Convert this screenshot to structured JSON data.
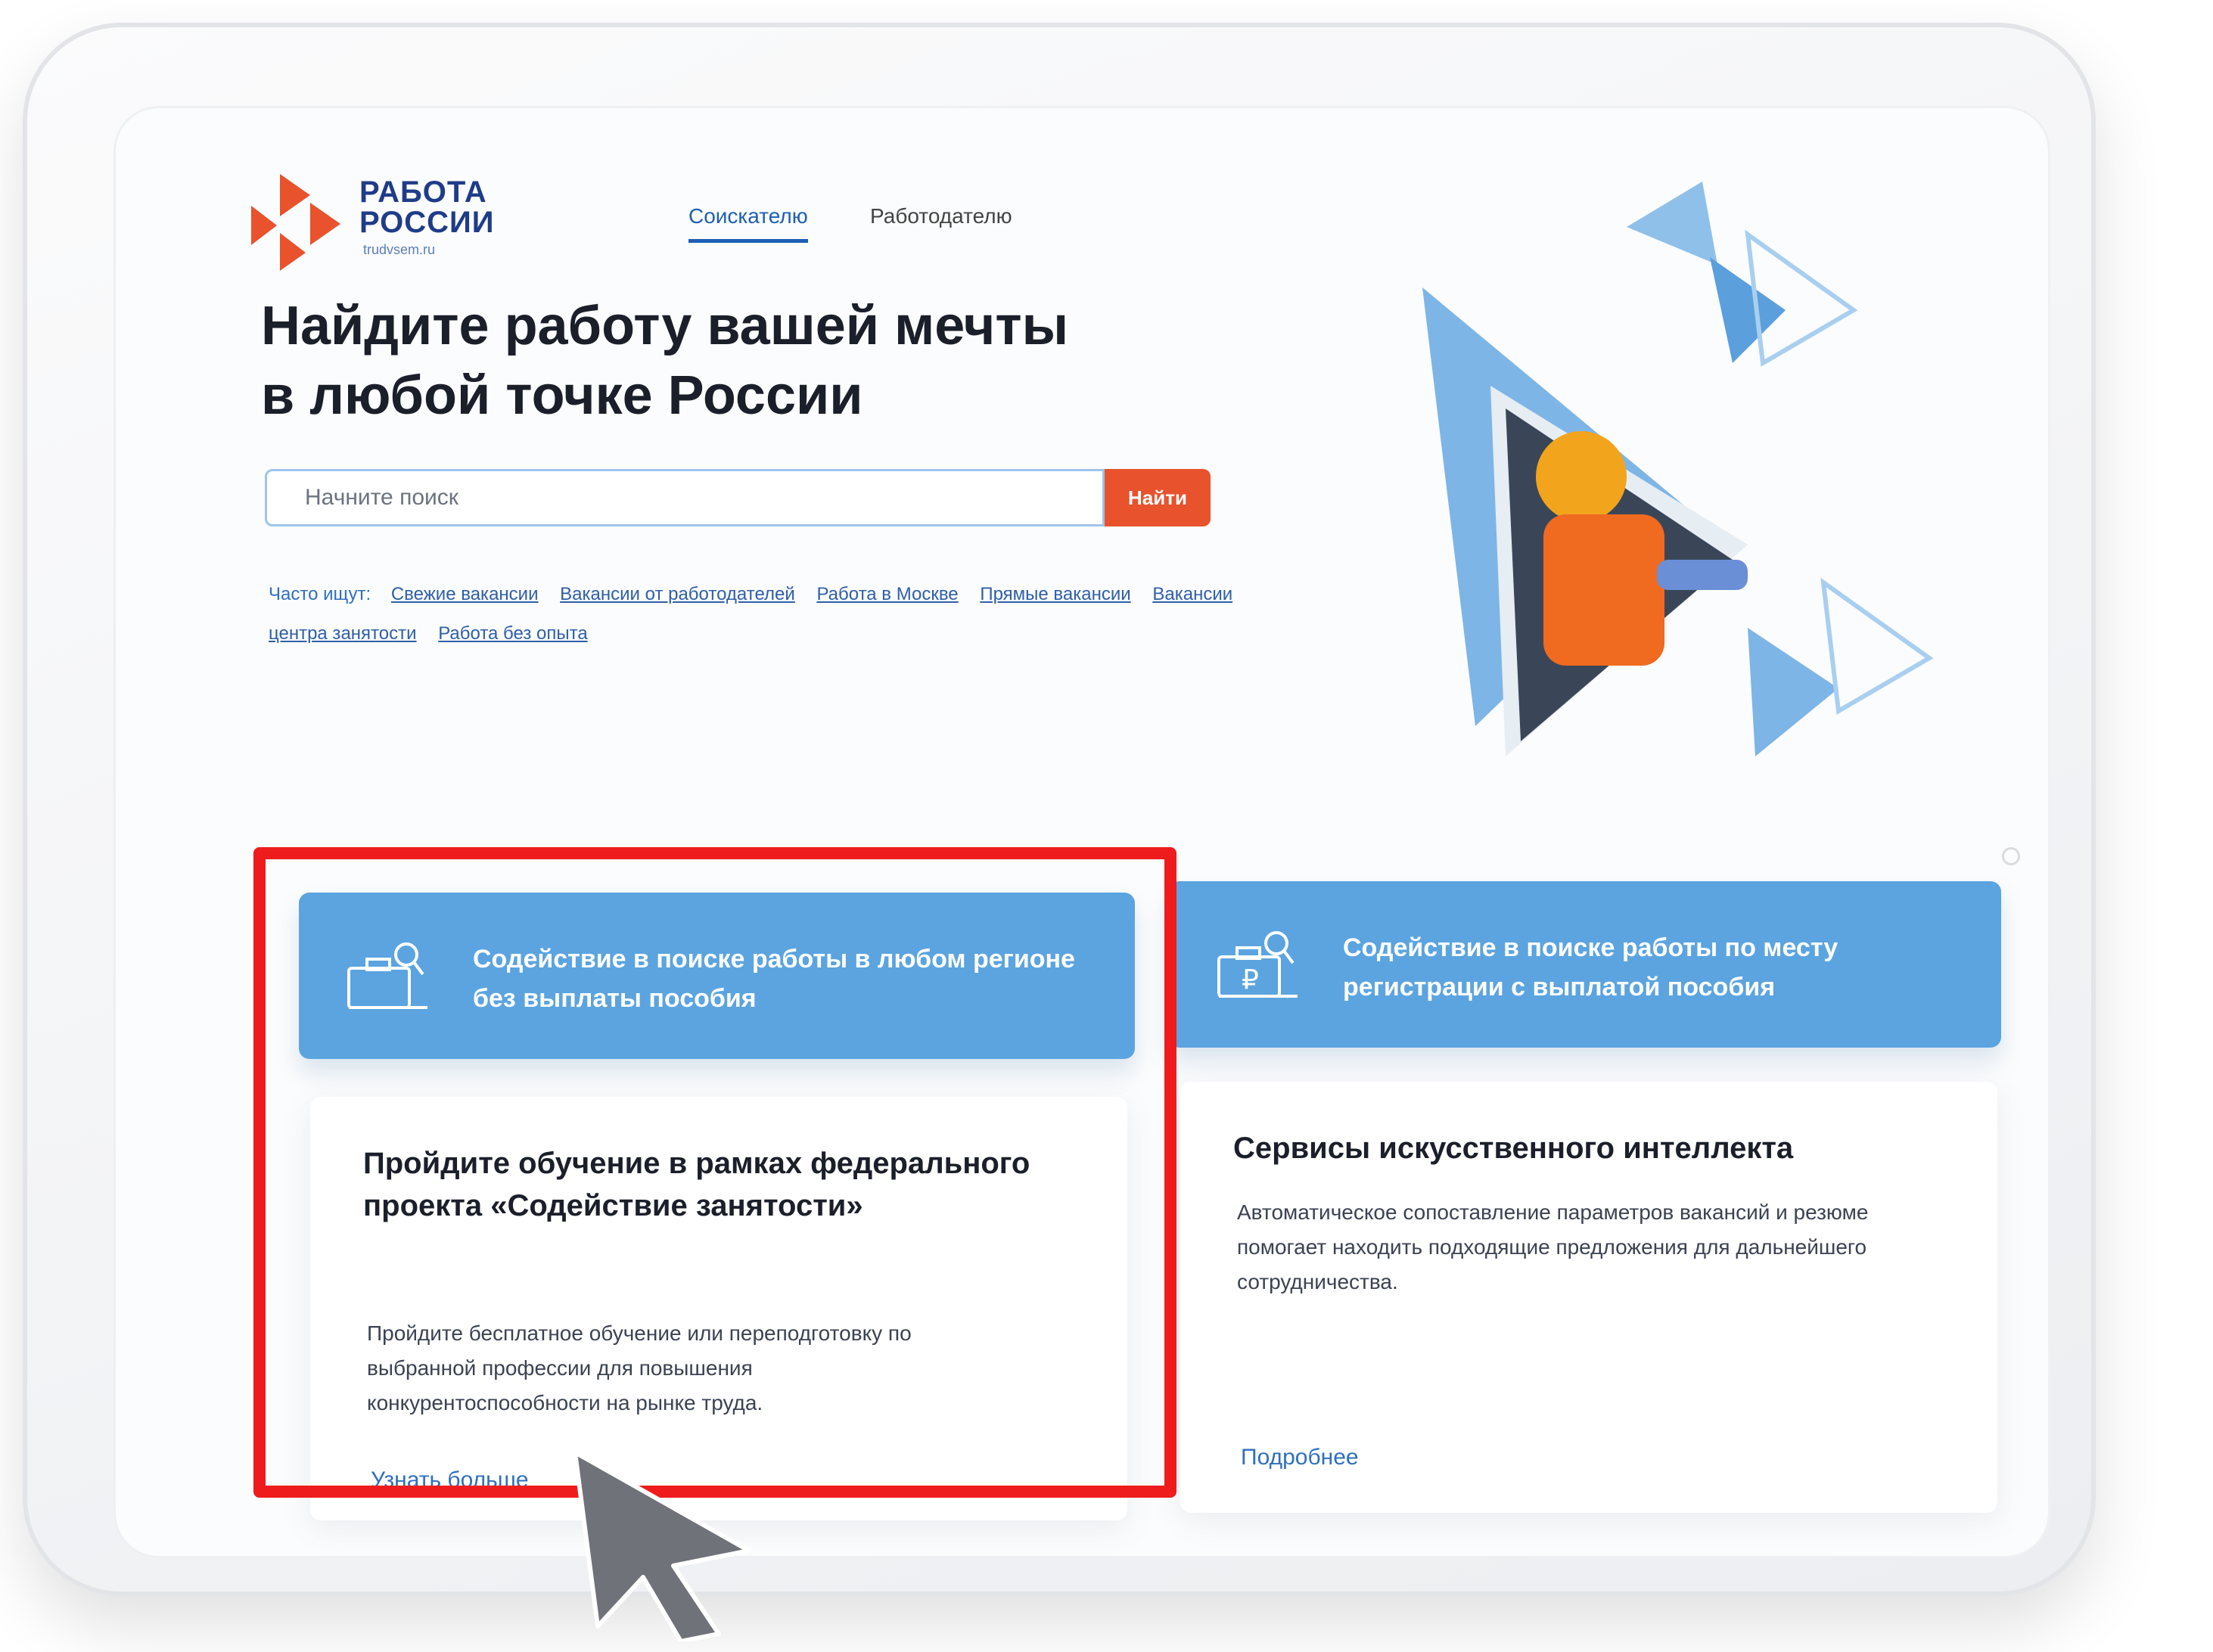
{
  "logo": {
    "line1": "РАБОТА",
    "line2": "РОССИИ",
    "domain": "trudvsem.ru",
    "accent_color": "#e8522c",
    "text_color": "#1f3c88"
  },
  "tabs": [
    {
      "label": "Соискателю",
      "active": true
    },
    {
      "label": "Работодателю",
      "active": false
    }
  ],
  "headline": {
    "line1": "Найдите работу вашей мечты",
    "line2": "в любой точке России"
  },
  "search": {
    "placeholder": "Начните поиск",
    "button_label": "Найти"
  },
  "frequent": {
    "label": "Часто ищут:",
    "links": [
      "Свежие вакансии",
      "Вакансии от работодателей",
      "Работа в Москве",
      "Прямые вакансии",
      "Вакансии центра занятости",
      "Работа без опыта"
    ]
  },
  "cards_blue": [
    {
      "text": "Содействие в поиске работы в любом регионе без выплаты пособия",
      "icon": "briefcase-search-icon"
    },
    {
      "text": "Содействие в поиске работы по месту регистрации с выплатой пособия",
      "icon": "briefcase-ruble-search-icon"
    }
  ],
  "cards_white": [
    {
      "title": "Пройдите обучение в рамках федерального проекта «Содействие занятости»",
      "description": "Пройдите бесплатное обучение или переподготовку по выбранной профессии для повышения конкурентоспособности на рынке труда.",
      "link": "Узнать больше"
    },
    {
      "title": "Сервисы искусственного интеллекта",
      "description": "Автоматическое сопоставление параметров вакансий и резюме помогает находить подходящие предложения для дальнейшего сотрудничества.",
      "link": "Подробнее"
    }
  ],
  "colors": {
    "primary_blue": "#5ba4e0",
    "link_blue": "#2f6fbf",
    "highlight_red": "#ee1c1c",
    "search_button": "#e8522c"
  }
}
